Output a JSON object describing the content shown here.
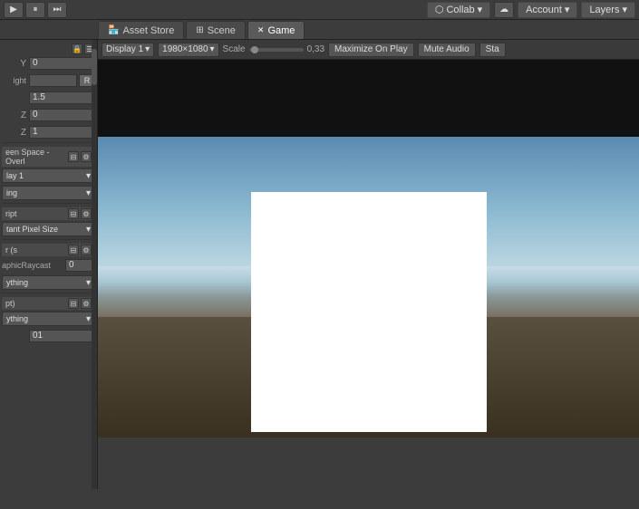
{
  "toolbar": {
    "play_label": "▶",
    "pause_label": "⏸",
    "step_label": "⏭",
    "collab_label": "Collab",
    "collab_icon": "⬡",
    "cloud_icon": "☁",
    "account_label": "Account",
    "account_arrow": "▾",
    "layers_label": "Layers",
    "layers_arrow": "▾"
  },
  "tabs": [
    {
      "id": "asset-store",
      "label": "Asset Store",
      "icon": "🏪",
      "active": false
    },
    {
      "id": "scene",
      "label": "Scene",
      "icon": "⊞",
      "active": false
    },
    {
      "id": "game",
      "label": "Game",
      "icon": "🎮",
      "active": true
    }
  ],
  "game_toolbar": {
    "display_label": "Display 1",
    "resolution_label": "1980×1080",
    "scale_label": "Scale",
    "scale_value": "0,33",
    "maximize_label": "Maximize On Play",
    "mute_label": "Mute Audio",
    "stats_label": "Sta"
  },
  "left_panel": {
    "pos_y_label": "Y",
    "pos_y_value": "0",
    "pos_z_label": "",
    "height_label": "ight",
    "r_btn": "R",
    "val_1": "1.5",
    "z_0_label": "Z",
    "z_0_value": "0",
    "z_1_label": "Z",
    "z_1_value": "1",
    "section1_label": "een Space - Overl",
    "section1_icons": [
      "⊟",
      "⚙"
    ],
    "section2_label": "lay 1",
    "section3_label": "ing",
    "section4_label": "ript",
    "section4_icons": [
      "⊟",
      "⚙"
    ],
    "section5_label": "tant Pixel Size",
    "section6_label": "r (s",
    "section6_icons": [
      "⊟",
      "⚙"
    ],
    "section7_label": "aphicRaycast",
    "section7_value": "0",
    "section8_label": "ything",
    "section9_label": "pt)",
    "section9_icons": [
      "⊟",
      "⚙"
    ],
    "section10_label": "ything",
    "section10_value": "01"
  },
  "colors": {
    "bg": "#3c3c3c",
    "panel_bg": "#3c3c3c",
    "tab_active": "#5a5a5a",
    "tab_inactive": "#4a4a4a",
    "sky_top": "#5a8ab0",
    "sky_bottom": "#cce0e8",
    "ground_top": "#5a5040",
    "ground_bottom": "#3a3020"
  }
}
